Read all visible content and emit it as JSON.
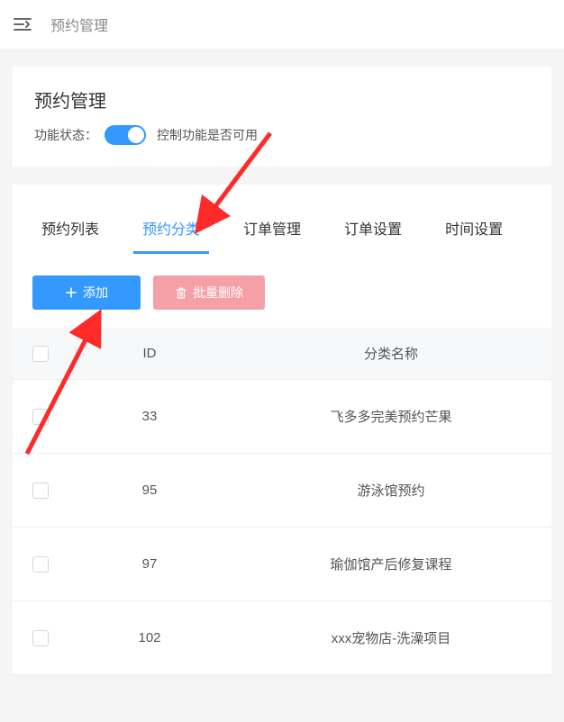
{
  "topbar": {
    "breadcrumb": "预约管理"
  },
  "header_panel": {
    "title": "预约管理",
    "func_label": "功能状态：",
    "func_desc": "控制功能是否可用"
  },
  "tabs": [
    {
      "label": "预约列表",
      "active": false
    },
    {
      "label": "预约分类",
      "active": true
    },
    {
      "label": "订单管理",
      "active": false
    },
    {
      "label": "订单设置",
      "active": false
    },
    {
      "label": "时间设置",
      "active": false
    }
  ],
  "buttons": {
    "add": "添加",
    "bulk_delete": "批量删除"
  },
  "table": {
    "headers": {
      "id": "ID",
      "name": "分类名称"
    },
    "rows": [
      {
        "id": "33",
        "name": "飞多多完美预约芒果"
      },
      {
        "id": "95",
        "name": "游泳馆预约"
      },
      {
        "id": "97",
        "name": "瑜伽馆产后修复课程"
      },
      {
        "id": "102",
        "name": "xxx宠物店-洗澡项目"
      }
    ]
  }
}
